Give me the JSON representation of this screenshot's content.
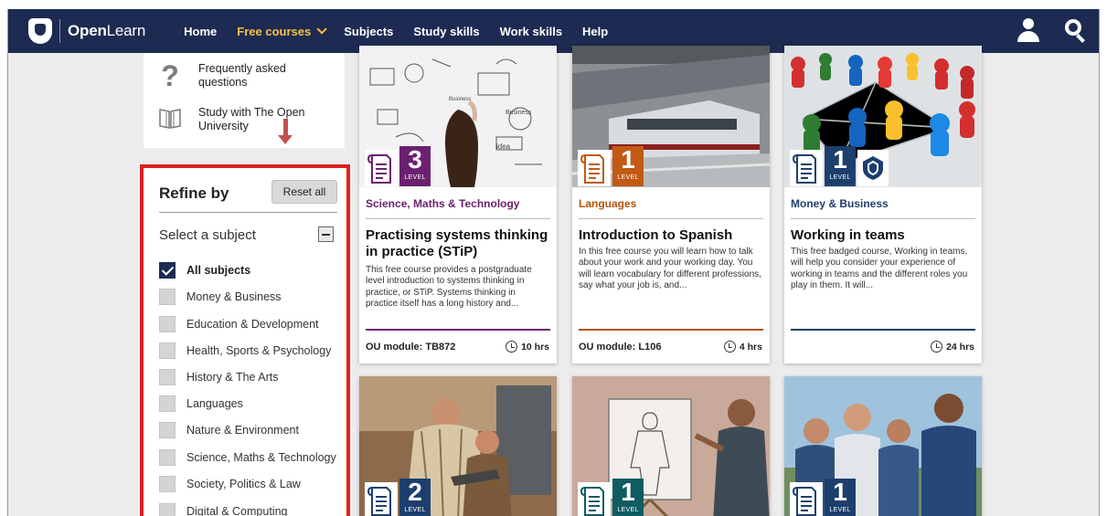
{
  "nav": {
    "logo_bold": "Open",
    "logo_light": "Learn",
    "items": [
      {
        "label": "Home"
      },
      {
        "label": "Free courses"
      },
      {
        "label": "Subjects"
      },
      {
        "label": "Study skills"
      },
      {
        "label": "Work skills"
      },
      {
        "label": "Help"
      }
    ],
    "active_item": "Free courses"
  },
  "help_links": [
    {
      "label": "Frequently asked questions",
      "icon": "question-icon"
    },
    {
      "label": "Study with The Open University",
      "icon": "book-icon"
    }
  ],
  "refine": {
    "title": "Refine by",
    "reset_label": "Reset all",
    "subject_title": "Select a subject",
    "subjects": [
      {
        "label": "All subjects",
        "checked": true
      },
      {
        "label": "Money & Business",
        "checked": false
      },
      {
        "label": "Education & Development",
        "checked": false
      },
      {
        "label": "Health, Sports & Psychology",
        "checked": false
      },
      {
        "label": "History & The Arts",
        "checked": false
      },
      {
        "label": "Languages",
        "checked": false
      },
      {
        "label": "Nature & Environment",
        "checked": false
      },
      {
        "label": "Science, Maths & Technology",
        "checked": false
      },
      {
        "label": "Society, Politics & Law",
        "checked": false
      },
      {
        "label": "Digital & Computing",
        "checked": false
      }
    ]
  },
  "cards": [
    {
      "level": "3",
      "level_text": "LEVEL",
      "level_color": "#6b2070",
      "category": "Science, Maths & Technology",
      "category_color": "#6b2070",
      "title": "Practising systems thinking in practice (STiP)",
      "description": "This free course provides a postgraduate level introduction to systems thinking in practice, or STiP. Systems thinking in practice itself has a long history and...",
      "module": "OU module: TB872",
      "hours": "10 hrs"
    },
    {
      "level": "1",
      "level_text": "LEVEL",
      "level_color": "#c25a14",
      "category": "Languages",
      "category_color": "#b45309",
      "title": "Introduction to Spanish",
      "description": "In this free course you will learn how to talk about your work and your working day. You will learn vocabulary for different professions, say what your job is, and...",
      "module": "OU module: L106",
      "hours": "4 hrs"
    },
    {
      "level": "1",
      "level_text": "LEVEL",
      "level_color": "#1d3f6e",
      "category": "Money & Business",
      "category_color": "#1d3f6e",
      "title": "Working in teams",
      "description": "This free badged course, Working in teams, will help you consider your experience of working in teams and the different roles you play in them. It will...",
      "module": "",
      "hours": "24 hrs",
      "badged": true
    },
    {
      "level": "2",
      "level_text": "LEVEL",
      "level_color": "#1d3f6e"
    },
    {
      "level": "1",
      "level_text": "LEVEL",
      "level_color": "#0f5c63"
    },
    {
      "level": "1",
      "level_text": "LEVEL",
      "level_color": "#1d3f6e"
    }
  ]
}
